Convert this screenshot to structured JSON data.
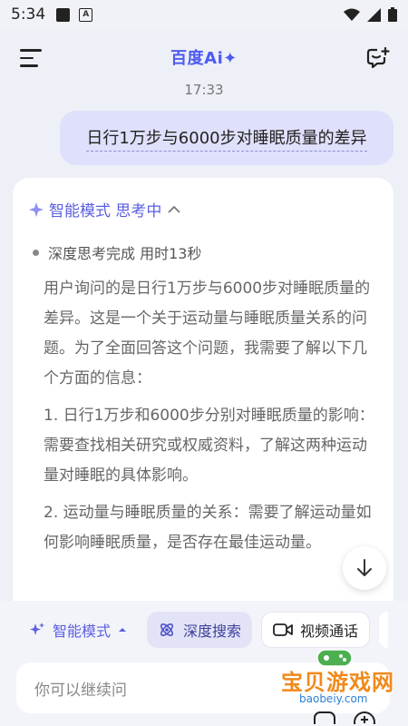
{
  "status": {
    "time": "5:34"
  },
  "header": {
    "logo": "百度Ai✦"
  },
  "chat": {
    "time": "17:33",
    "user_message": "日行1万步与6000步对睡眠质量的差异"
  },
  "answer": {
    "mode_label": "智能模式 思考中",
    "thought_status": "深度思考完成 用时13秒",
    "paragraphs": [
      "用户询问的是日行1万步与6000步对睡眠质量的差异。这是一个关于运动量与睡眠质量关系的问题。为了全面回答这个问题，我需要了解以下几个方面的信息：",
      "1. 日行1万步和6000步分别对睡眠质量的影响：需要查找相关研究或权威资料，了解这两种运动量对睡眠的具体影响。",
      "2. 运动量与睡眠质量的关系：需要了解运动量如何影响睡眠质量，是否存在最佳运动量。"
    ]
  },
  "toolbar": {
    "mode_chip": "智能模式",
    "search_chip": "深度搜索",
    "video_chip": "视频通话"
  },
  "input": {
    "placeholder": "你可以继续问"
  },
  "watermark": {
    "name": "宝贝游戏网",
    "url": "baobeiy.com"
  },
  "colors": {
    "accent": "#5b5fe0",
    "bubble": "#dfe0fb",
    "background": "#eef0f7"
  }
}
